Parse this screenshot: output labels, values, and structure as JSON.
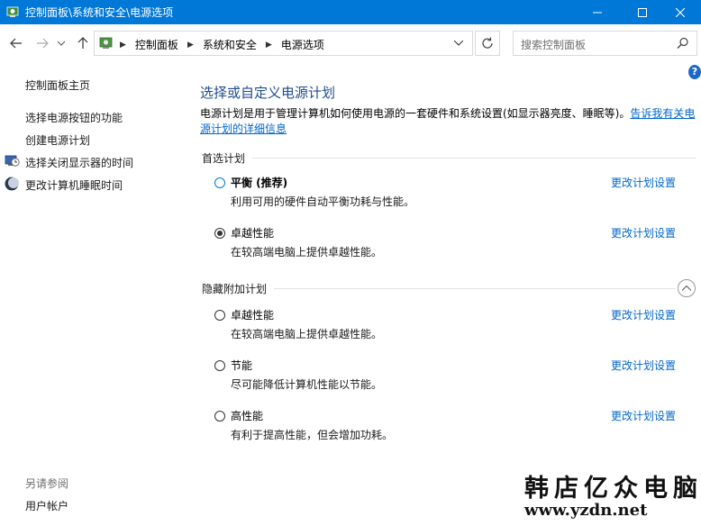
{
  "window": {
    "title": "控制面板\\系统和安全\\电源选项"
  },
  "address_bar": {
    "crumbs": [
      "控制面板",
      "系统和安全",
      "电源选项"
    ]
  },
  "search": {
    "placeholder": "搜索控制面板"
  },
  "sidebar": {
    "home": "控制面板主页",
    "links": [
      {
        "label": "选择电源按钮的功能",
        "icon": null
      },
      {
        "label": "创建电源计划",
        "icon": null
      },
      {
        "label": "选择关闭显示器的时间",
        "icon": "monitor-clock-icon"
      },
      {
        "label": "更改计算机睡眠时间",
        "icon": "moon-icon"
      }
    ],
    "see_also": "另请参阅",
    "see_also_links": [
      "用户帐户"
    ]
  },
  "main": {
    "heading": "选择或自定义电源计划",
    "description": "电源计划是用于管理计算机如何使用电源的一套硬件和系统设置(如显示器亮度、睡眠等)。",
    "description_link": "告诉我有关电源计划的详细信息",
    "preferred_group": "首选计划",
    "preferred_plans": [
      {
        "name": "平衡 (推荐)",
        "desc": "利用可用的硬件自动平衡功耗与性能。",
        "selected": false,
        "link": "更改计划设置"
      },
      {
        "name": "卓越性能",
        "desc": "在较高端电脑上提供卓越性能。",
        "selected": true,
        "link": "更改计划设置"
      }
    ],
    "hidden_group": "隐藏附加计划",
    "hidden_plans": [
      {
        "name": "卓越性能",
        "desc": "在较高端电脑上提供卓越性能。",
        "selected": false,
        "link": "更改计划设置"
      },
      {
        "name": "节能",
        "desc": "尽可能降低计算机性能以节能。",
        "selected": false,
        "link": "更改计划设置"
      },
      {
        "name": "高性能",
        "desc": "有利于提高性能，但会增加功耗。",
        "selected": false,
        "link": "更改计划设置"
      }
    ]
  },
  "watermark": {
    "text": "韩店亿众电脑",
    "url": "www.yzdn.net"
  },
  "colors": {
    "titlebar": "#0078d7",
    "link": "#0066cc",
    "heading": "#1e4e8c"
  }
}
